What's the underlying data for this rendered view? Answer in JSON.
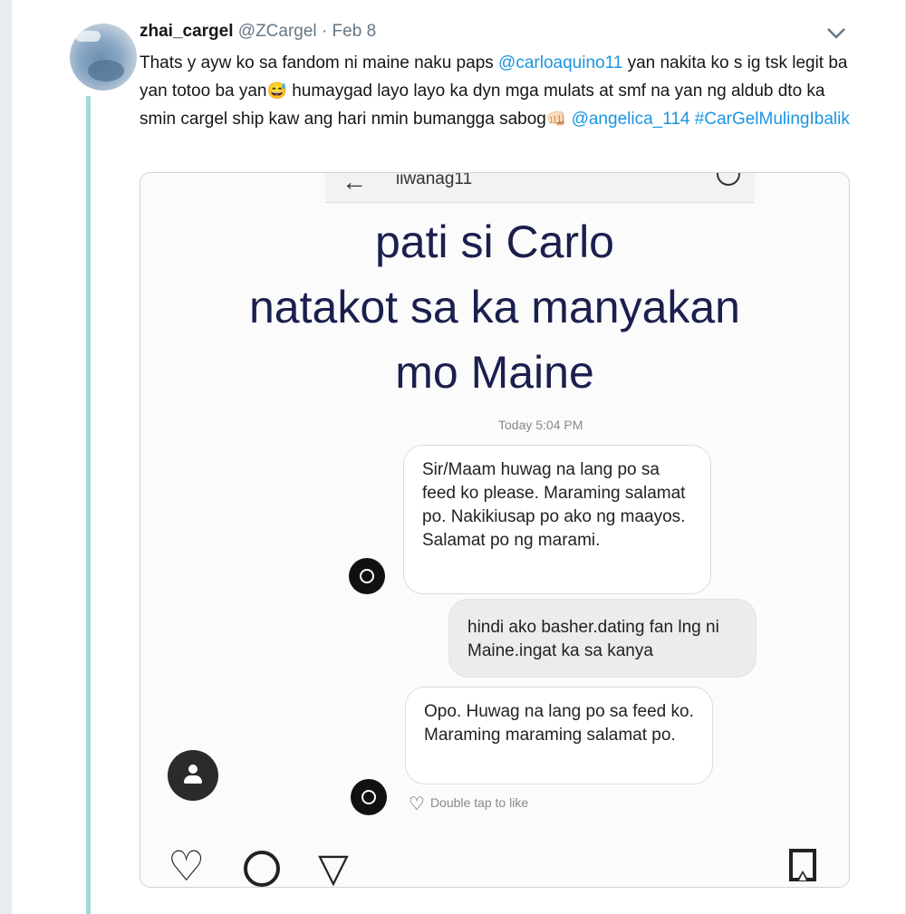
{
  "tweet": {
    "display_name": "zhai_cargel",
    "handle": "@ZCargel",
    "separator": "·",
    "date": "Feb 8",
    "text_segments": [
      {
        "type": "text",
        "text": "Thats y ayw ko sa fandom ni maine naku paps "
      },
      {
        "type": "mention",
        "text": "@carloaquino11"
      },
      {
        "type": "text",
        "text": "  yan nakita ko s ig tsk legit ba yan totoo ba yan"
      },
      {
        "type": "emoji",
        "text": "😅"
      },
      {
        "type": "text",
        "text": " humaygad layo layo ka dyn mga mulats at smf na yan ng aldub dto ka smin cargel ship kaw ang hari nmin bumangga sabog"
      },
      {
        "type": "emoji",
        "text": "👊🏻"
      },
      {
        "type": "text",
        "text": " "
      },
      {
        "type": "mention",
        "text": "@angelica_114"
      },
      {
        "type": "text",
        "text": " "
      },
      {
        "type": "hashtag",
        "text": "#CarGelMulingIbalik"
      }
    ]
  },
  "icons": {
    "caret": "chevron-down-icon",
    "back": "back-arrow-icon",
    "info": "info-icon",
    "like": "heart-icon",
    "comment": "comment-icon",
    "send": "send-icon",
    "save": "bookmark-icon"
  },
  "colors": {
    "link": "#1b95e0",
    "thread_line": "#9fdcd4",
    "headline": "#1b1f4e",
    "page_bg": "#e6ecf0"
  },
  "image": {
    "topbar_username": "iiwanag11",
    "back_glyph": "←",
    "headline": [
      "pati si Carlo",
      "natakot sa ka manyakan",
      "mo Maine"
    ],
    "timestamp": "Today 5:04 PM",
    "messages": [
      {
        "side": "left",
        "text": "Sir/Maam huwag na lang po sa feed ko please. Maraming salamat po. Nakikiusap po ako ng maayos. Salamat po ng marami."
      },
      {
        "side": "right",
        "text": "hindi ako basher.dating fan lng ni Maine.ingat ka sa kanya"
      },
      {
        "side": "left",
        "text": "Opo. Huwag na lang po sa feed ko. Maraming maraming salamat po."
      }
    ],
    "double_tap_heart": "♡",
    "double_tap": "Double tap to like",
    "like_glyph": "♡",
    "send_glyph": "▽"
  }
}
